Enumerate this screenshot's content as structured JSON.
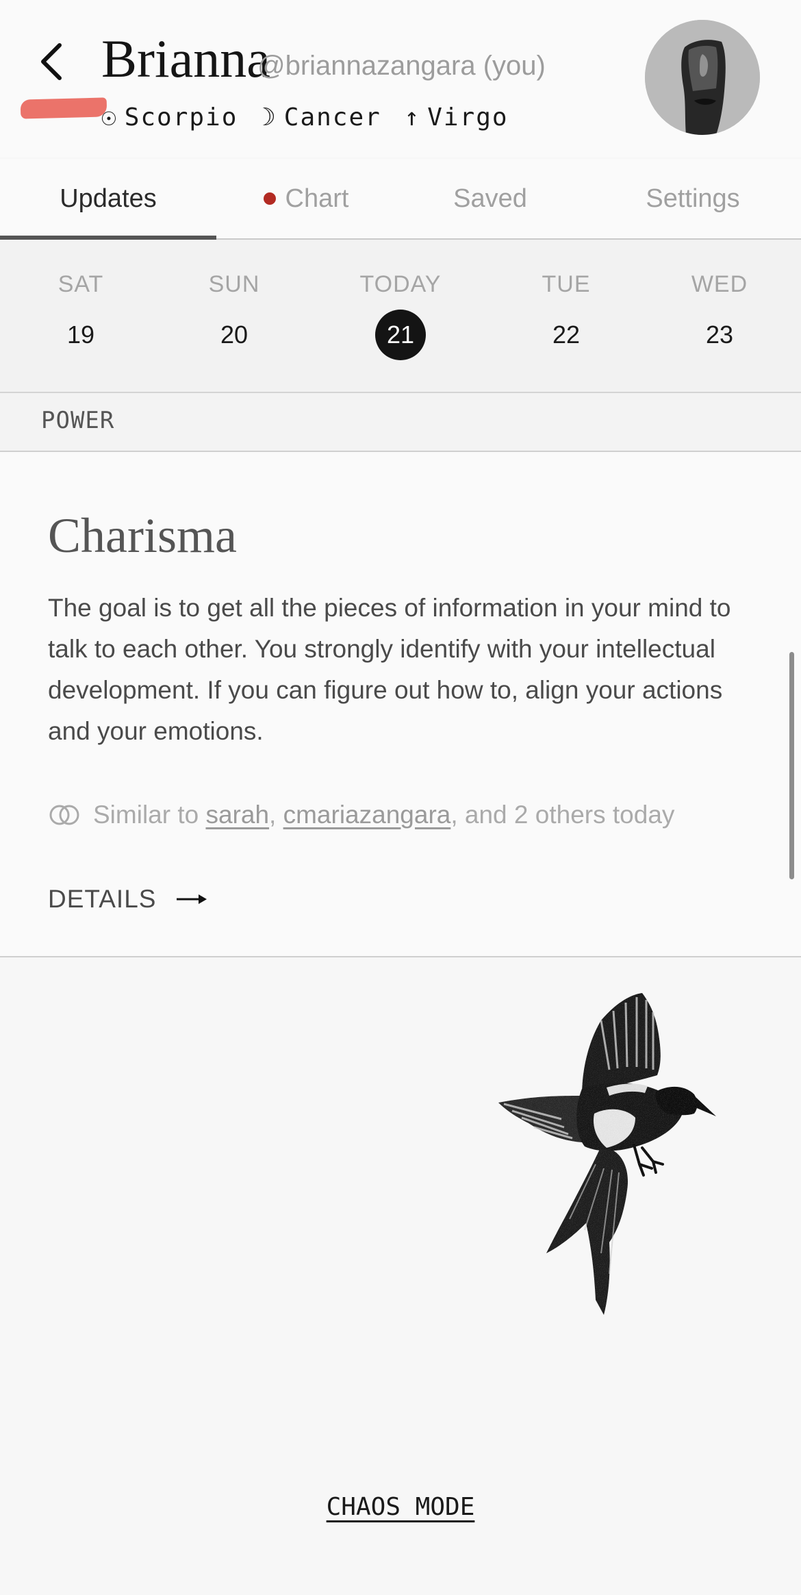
{
  "profile": {
    "name": "Brianna",
    "handle": "@briannazangara (you)",
    "signs": {
      "sun_symbol": "☉",
      "sun": "Scorpio",
      "moon_symbol": "☽",
      "moon": "Cancer",
      "rising_symbol": "↑",
      "rising": "Virgo"
    }
  },
  "tabs": [
    {
      "label": "Updates",
      "active": true
    },
    {
      "label": "Chart",
      "has_notification_dot": true
    },
    {
      "label": "Saved"
    },
    {
      "label": "Settings"
    }
  ],
  "dates": [
    {
      "dow": "SAT",
      "day": "19"
    },
    {
      "dow": "SUN",
      "day": "20"
    },
    {
      "dow": "TODAY",
      "day": "21",
      "selected": true
    },
    {
      "dow": "TUE",
      "day": "22"
    },
    {
      "dow": "WED",
      "day": "23"
    }
  ],
  "section": {
    "label": "POWER"
  },
  "card": {
    "title": "Charisma",
    "body": "The goal is to get all the pieces of information in your mind to talk to each other. You strongly identify with your intellectual development. If you can figure out how to, align your actions and your emotions.",
    "similar": {
      "prefix": "Similar to",
      "user1": "sarah",
      "sep": ",",
      "user2": "cmariazangara",
      "suffix": ", and 2 others today"
    },
    "details_label": "DETAILS"
  },
  "footer": {
    "chaos_label": "CHAOS MODE"
  },
  "colors": {
    "notification_dot": "#b22a22",
    "today_circle": "#141414",
    "highlight_swash": "#e85a50"
  },
  "icons": {
    "back": "chevron-left-icon",
    "similar": "overlapping-rings-icon",
    "details": "arrow-right-icon",
    "illustration": "magpie-bird-illustration"
  }
}
